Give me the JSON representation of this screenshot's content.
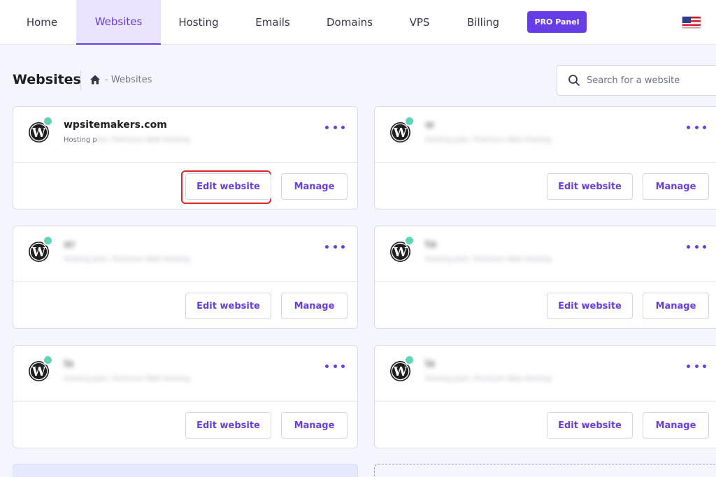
{
  "nav": {
    "items": [
      {
        "label": "Home",
        "active": false
      },
      {
        "label": "Websites",
        "active": true
      },
      {
        "label": "Hosting",
        "active": false
      },
      {
        "label": "Emails",
        "active": false
      },
      {
        "label": "Domains",
        "active": false
      },
      {
        "label": "VPS",
        "active": false
      },
      {
        "label": "Billing",
        "active": false
      }
    ],
    "pro_panel_label": "PRO Panel",
    "language_flag": "us-flag-icon"
  },
  "header": {
    "title": "Websites",
    "breadcrumb": "- Websites",
    "search_placeholder": "Search for a website"
  },
  "websites": [
    {
      "domain": "wpsitemakers.com",
      "plan": "Hosting plan: Premium Web Hosting",
      "domain_blurred": false,
      "plan_partially_visible": "Hosting p",
      "edit_label": "Edit website",
      "manage_label": "Manage",
      "status": "active"
    },
    {
      "domain": "w",
      "plan": "Hosting plan: Premium Web Hosting",
      "domain_blurred": true,
      "edit_label": "Edit website",
      "manage_label": "Manage",
      "status": "active"
    },
    {
      "domain": "ar",
      "plan": "Hosting plan: Premium Web Hosting",
      "domain_blurred": true,
      "edit_label": "Edit website",
      "manage_label": "Manage",
      "status": "active"
    },
    {
      "domain": "ta",
      "plan": "Hosting plan: Premium Web Hosting",
      "domain_blurred": true,
      "edit_label": "Edit website",
      "manage_label": "Manage",
      "status": "active"
    },
    {
      "domain": "la",
      "plan": "Hosting plan: Premium Web Hosting",
      "domain_blurred": true,
      "edit_label": "Edit website",
      "manage_label": "Manage",
      "status": "active"
    },
    {
      "domain": "la",
      "plan": "Hosting plan: Premium Web Hosting",
      "domain_blurred": true,
      "edit_label": "Edit website",
      "manage_label": "Manage",
      "status": "active"
    }
  ],
  "colors": {
    "accent": "#673de6",
    "status_active": "#5ed6b5",
    "highlight": "#d7282f",
    "background": "#f4f5ff"
  }
}
